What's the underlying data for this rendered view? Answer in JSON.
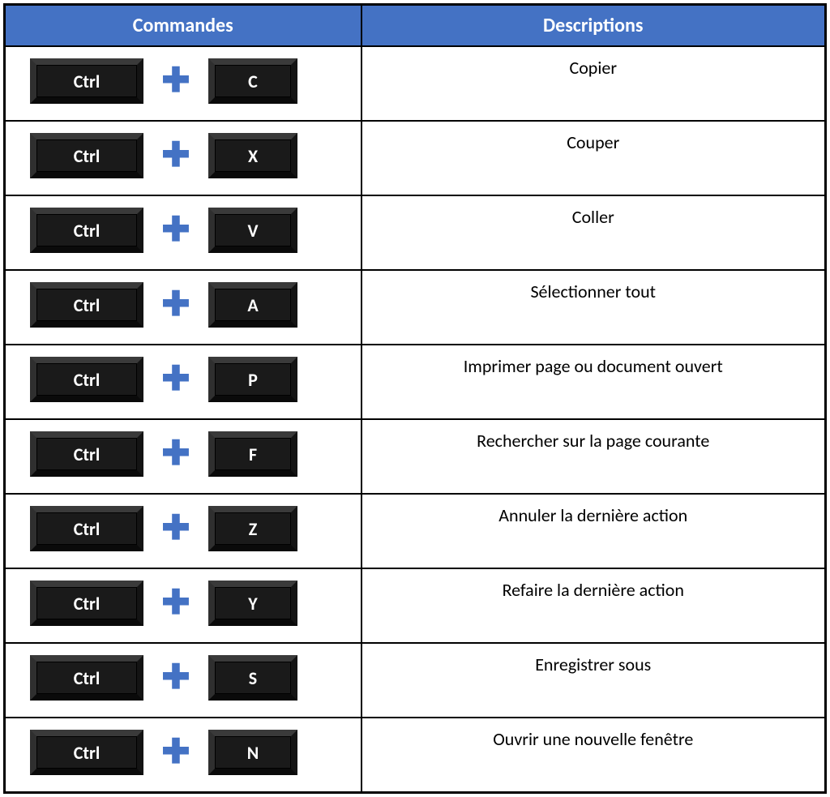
{
  "headers": {
    "commands": "Commandes",
    "descriptions": "Descriptions"
  },
  "plus_symbol": "✚",
  "rows": [
    {
      "key1": "Ctrl",
      "key2": "C",
      "desc": "Copier"
    },
    {
      "key1": "Ctrl",
      "key2": "X",
      "desc": "Couper"
    },
    {
      "key1": "Ctrl",
      "key2": "V",
      "desc": "Coller"
    },
    {
      "key1": "Ctrl",
      "key2": "A",
      "desc": "Sélectionner tout"
    },
    {
      "key1": "Ctrl",
      "key2": "P",
      "desc": "Imprimer page ou document ouvert"
    },
    {
      "key1": "Ctrl",
      "key2": "F",
      "desc": "Rechercher sur la page courante"
    },
    {
      "key1": "Ctrl",
      "key2": "Z",
      "desc": "Annuler la dernière action"
    },
    {
      "key1": "Ctrl",
      "key2": "Y",
      "desc": "Refaire la dernière action"
    },
    {
      "key1": "Ctrl",
      "key2": "S",
      "desc": "Enregistrer sous"
    },
    {
      "key1": "Ctrl",
      "key2": "N",
      "desc": "Ouvrir une nouvelle fenêtre"
    }
  ]
}
